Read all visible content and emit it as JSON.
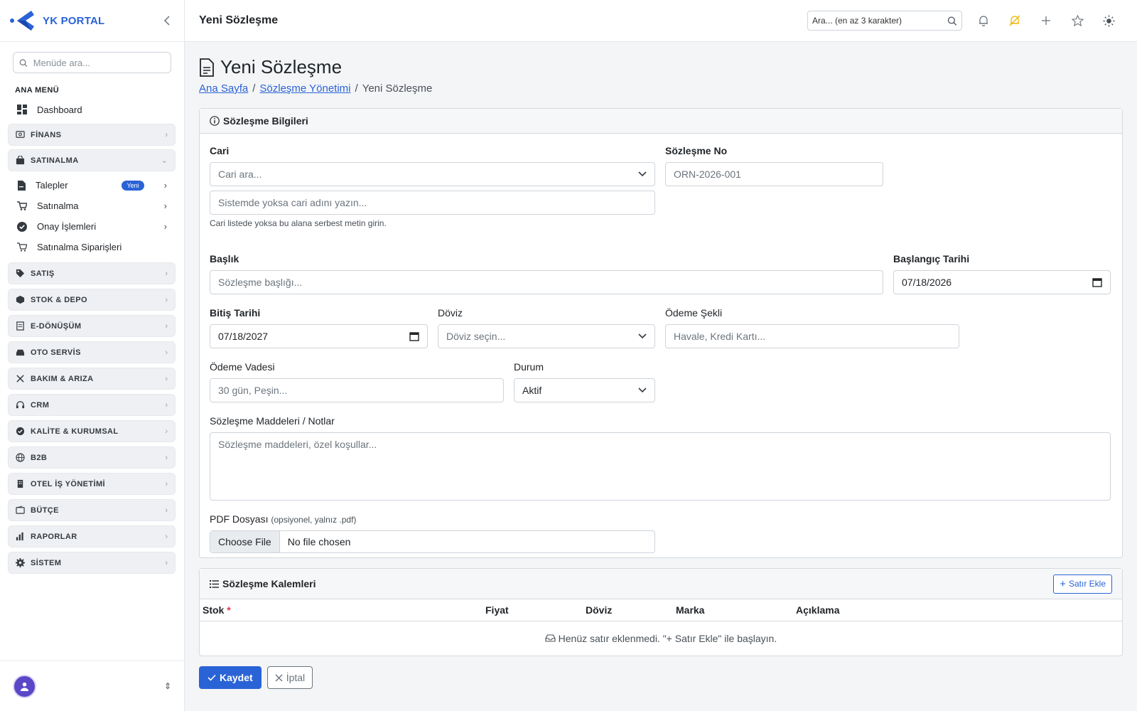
{
  "brand": {
    "name": "YK PORTAL"
  },
  "sidebar": {
    "search_placeholder": "Menüde ara...",
    "section": "ANA MENÜ",
    "dashboard": "Dashboard",
    "groups_top": [
      {
        "label": "FİNANS",
        "icon": "finance-icon"
      },
      {
        "label": "SATINALMA",
        "icon": "bag-icon"
      }
    ],
    "satinalma_items": [
      {
        "label": "Talepler",
        "badge": "Yeni"
      },
      {
        "label": "Satınalma"
      },
      {
        "label": "Onay İşlemleri"
      },
      {
        "label": "Satınalma Siparişleri"
      }
    ],
    "groups": [
      {
        "label": "SATIŞ",
        "icon": "tag-icon"
      },
      {
        "label": "STOK & DEPO",
        "icon": "box-icon"
      },
      {
        "label": "E-DÖNÜŞÜM",
        "icon": "document-icon"
      },
      {
        "label": "OTO SERVİS",
        "icon": "car-icon"
      },
      {
        "label": "BAKIM & ARIZA",
        "icon": "tools-icon"
      },
      {
        "label": "CRM",
        "icon": "headset-icon"
      },
      {
        "label": "KALİTE & KURUMSAL",
        "icon": "quality-icon"
      },
      {
        "label": "B2B",
        "icon": "globe-icon"
      },
      {
        "label": "OTEL İŞ YÖNETİMİ",
        "icon": "building-icon"
      },
      {
        "label": "BÜTÇE",
        "icon": "wallet-icon"
      },
      {
        "label": "RAPORLAR",
        "icon": "chart-icon"
      },
      {
        "label": "SİSTEM",
        "icon": "gear-icon"
      }
    ]
  },
  "topbar": {
    "title": "Yeni Sözleşme",
    "search_placeholder": "Ara... (en az 3 karakter)"
  },
  "page": {
    "title": "Yeni Sözleşme",
    "breadcrumb": [
      "Ana Sayfa",
      "Sözleşme Yönetimi",
      "Yeni Sözleşme"
    ],
    "sep": "/"
  },
  "info_card": {
    "title": "Sözleşme Bilgileri",
    "cari_label": "Cari",
    "cari_placeholder": "Cari ara...",
    "cari_free_placeholder": "Sistemde yoksa cari adını yazın...",
    "cari_hint": "Cari listede yoksa bu alana serbest metin girin.",
    "no_label": "Sözleşme No",
    "no_placeholder": "ORN-2026-001",
    "baslik_label": "Başlık",
    "baslik_placeholder": "Sözleşme başlığı...",
    "start_label": "Başlangıç Tarihi",
    "start_value": "07/18/2026",
    "end_label": "Bitiş Tarihi",
    "end_value": "07/18/2027",
    "doviz_label": "Döviz",
    "doviz_placeholder": "Döviz seçin...",
    "odeme_label": "Ödeme Şekli",
    "odeme_placeholder": "Havale, Kredi Kartı...",
    "vade_label": "Ödeme Vadesi",
    "vade_placeholder": "30 gün, Peşin...",
    "durum_label": "Durum",
    "durum_value": "Aktif",
    "notes_label": "Sözleşme Maddeleri / Notlar",
    "notes_placeholder": "Sözleşme maddeleri, özel koşullar...",
    "pdf_label": "PDF Dosyası",
    "pdf_sub": "(opsiyonel, yalnız .pdf)",
    "file_button": "Choose File",
    "file_text": "No file chosen"
  },
  "items_card": {
    "title": "Sözleşme Kalemleri",
    "add_button": "Satır Ekle",
    "columns": [
      "Stok",
      "Fiyat",
      "Döviz",
      "Marka",
      "Açıklama"
    ],
    "required_mark": "*",
    "empty": "Henüz satır eklenmedi. \"+ Satır Ekle\" ile başlayın."
  },
  "actions": {
    "save": "Kaydet",
    "cancel": "İptal"
  },
  "colors": {
    "primary": "#2a63d6",
    "accent_bell": "#f0b400"
  }
}
